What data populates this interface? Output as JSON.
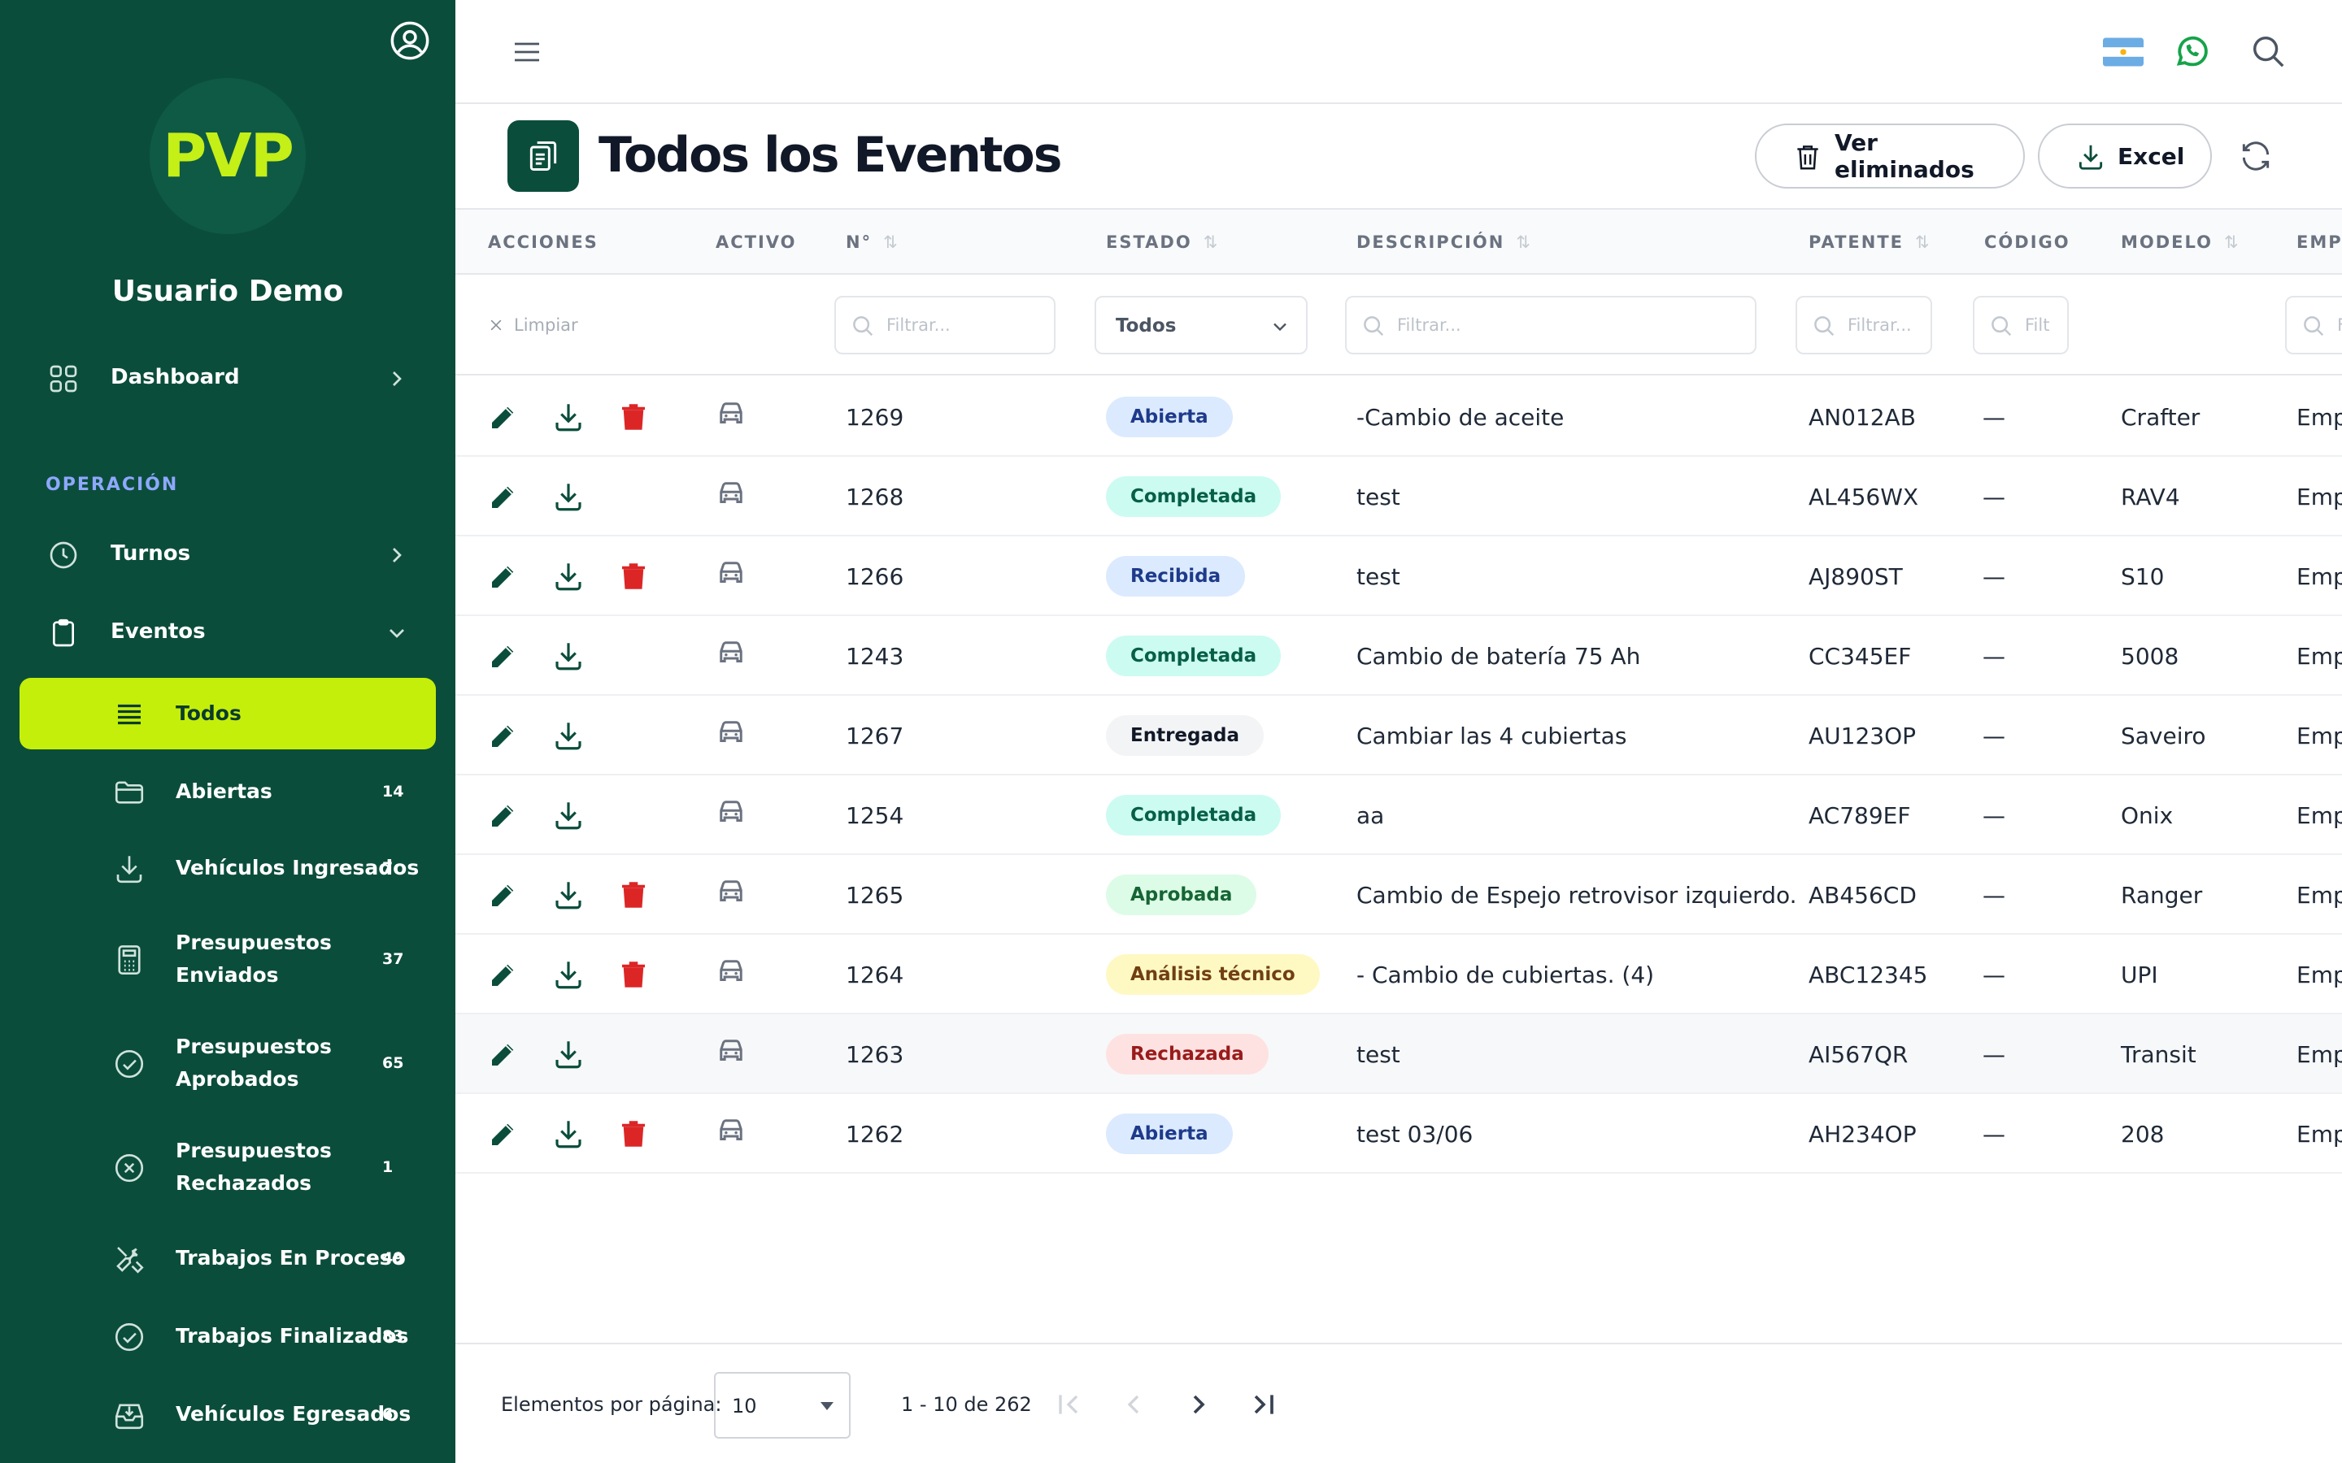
{
  "sidebar": {
    "logo": "PVP",
    "user_name": "Usuario Demo",
    "dashboard_label": "Dashboard",
    "section_title": "OPERACIÓN",
    "turnos_label": "Turnos",
    "eventos_label": "Eventos",
    "sub_items": [
      {
        "label": "Todos",
        "count": ""
      },
      {
        "label": "Abiertas",
        "count": "14"
      },
      {
        "label": "Vehículos Ingresados",
        "count": "7"
      },
      {
        "label": "Presupuestos\nEnviados",
        "line1": "Presupuestos",
        "line2": "Enviados",
        "count": "37"
      },
      {
        "label": "Presupuestos\nAprobados",
        "line1": "Presupuestos",
        "line2": "Aprobados",
        "count": "65"
      },
      {
        "label": "Presupuestos\nRechazados",
        "line1": "Presupuestos",
        "line2": "Rechazados",
        "count": "1"
      },
      {
        "label": "Trabajos En Proceso",
        "count": "49"
      },
      {
        "label": "Trabajos Finalizados",
        "count": "83"
      },
      {
        "label": "Vehículos Egresados",
        "count": "6"
      }
    ]
  },
  "header": {
    "title": "Todos los Eventos",
    "btn_deleted": "Ver eliminados",
    "btn_excel": "Excel"
  },
  "table": {
    "columns": {
      "acciones": "ACCIONES",
      "activo": "ACTIVO",
      "numero": "N°",
      "estado": "ESTADO",
      "descripcion": "DESCRIPCIÓN",
      "patente": "PATENTE",
      "codigo": "CÓDIGO",
      "modelo": "MODELO",
      "empresa": "EMPR"
    },
    "filters": {
      "clear": "Limpiar",
      "placeholder_numero": "Filtrar...",
      "status_selected": "Todos",
      "placeholder_descripcion": "Filtrar...",
      "placeholder_patente": "Filtrar...",
      "placeholder_codigo": "Filt",
      "placeholder_empresa": "F"
    },
    "rows": [
      {
        "numero": "1269",
        "estado": "Abierta",
        "descripcion": "-Cambio de aceite",
        "patente": "AN012AB",
        "codigo": "—",
        "modelo": "Crafter",
        "empresa": "Emp",
        "deletable": true
      },
      {
        "numero": "1268",
        "estado": "Completada",
        "descripcion": "test",
        "patente": "AL456WX",
        "codigo": "—",
        "modelo": "RAV4",
        "empresa": "Emp",
        "deletable": false
      },
      {
        "numero": "1266",
        "estado": "Recibida",
        "descripcion": "test",
        "patente": "AJ890ST",
        "codigo": "—",
        "modelo": "S10",
        "empresa": "Emp",
        "deletable": true
      },
      {
        "numero": "1243",
        "estado": "Completada",
        "descripcion": "Cambio de batería 75 Ah",
        "patente": "CC345EF",
        "codigo": "—",
        "modelo": "5008",
        "empresa": "Emp",
        "deletable": false
      },
      {
        "numero": "1267",
        "estado": "Entregada",
        "descripcion": "Cambiar las 4 cubiertas",
        "patente": "AU123OP",
        "codigo": "—",
        "modelo": "Saveiro",
        "empresa": "Emp",
        "deletable": false
      },
      {
        "numero": "1254",
        "estado": "Completada",
        "descripcion": "aa",
        "patente": "AC789EF",
        "codigo": "—",
        "modelo": "Onix",
        "empresa": "Emp",
        "deletable": false
      },
      {
        "numero": "1265",
        "estado": "Aprobada",
        "descripcion": "Cambio de Espejo retrovisor izquierdo.",
        "patente": "AB456CD",
        "codigo": "—",
        "modelo": "Ranger",
        "empresa": "Emp",
        "deletable": true
      },
      {
        "numero": "1264",
        "estado": "Análisis técnico",
        "descripcion": "- Cambio de cubiertas. (4)",
        "patente": "ABC12345",
        "codigo": "—",
        "modelo": "UPI",
        "empresa": "Emp",
        "deletable": true
      },
      {
        "numero": "1263",
        "estado": "Rechazada",
        "descripcion": "test",
        "patente": "AI567QR",
        "codigo": "—",
        "modelo": "Transit",
        "empresa": "Emp",
        "deletable": false
      },
      {
        "numero": "1262",
        "estado": "Abierta",
        "descripcion": "test 03/06",
        "patente": "AH234OP",
        "codigo": "—",
        "modelo": "208",
        "empresa": "Emp",
        "deletable": true
      }
    ]
  },
  "status_colors": {
    "Abierta": {
      "bg": "#dbeafe",
      "fg": "#1e3a8a"
    },
    "Completada": {
      "bg": "#ccfbf1",
      "fg": "#065f46"
    },
    "Recibida": {
      "bg": "#dbeafe",
      "fg": "#1e3a8a"
    },
    "Entregada": {
      "bg": "#f3f4f6",
      "fg": "#111827"
    },
    "Aprobada": {
      "bg": "#dcfce7",
      "fg": "#166534"
    },
    "Análisis técnico": {
      "bg": "#fef9c3",
      "fg": "#713f12"
    },
    "Rechazada": {
      "bg": "#fee2e2",
      "fg": "#991b1b"
    }
  },
  "footer": {
    "per_page_label": "Elementos por página:",
    "per_page_value": "10",
    "range": "1 - 10 de 262"
  },
  "colors": {
    "sidebar_bg": "#0b4d3b",
    "accent": "#c4ef0a",
    "delete_red": "#dc2626"
  }
}
